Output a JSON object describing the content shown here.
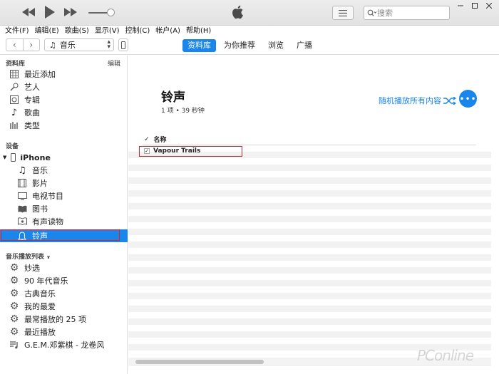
{
  "colors": {
    "accent": "#1a85ea",
    "highlight_border": "#e02020"
  },
  "search": {
    "placeholder": "搜索"
  },
  "menu": [
    "文件(F)",
    "编辑(E)",
    "歌曲(S)",
    "显示(V)",
    "控制(C)",
    "帐户(A)",
    "帮助(H)"
  ],
  "toolbar": {
    "media_type": "音乐"
  },
  "tabs": [
    {
      "label": "资料库",
      "active": true
    },
    {
      "label": "为你推荐",
      "active": false
    },
    {
      "label": "浏览",
      "active": false
    },
    {
      "label": "广播",
      "active": false
    }
  ],
  "sidebar": {
    "library_header": "资料库",
    "edit_label": "编辑",
    "library": [
      {
        "label": "最近添加",
        "icon": "recent-grid-icon"
      },
      {
        "label": "艺人",
        "icon": "microphone-icon"
      },
      {
        "label": "专辑",
        "icon": "album-icon"
      },
      {
        "label": "歌曲",
        "icon": "music-note-icon"
      },
      {
        "label": "类型",
        "icon": "genre-icon"
      }
    ],
    "devices_header": "设备",
    "device_name": "iPhone",
    "device_items": [
      {
        "label": "音乐",
        "icon": "music-note-icon"
      },
      {
        "label": "影片",
        "icon": "film-icon"
      },
      {
        "label": "电视节目",
        "icon": "tv-icon"
      },
      {
        "label": "图书",
        "icon": "book-icon"
      },
      {
        "label": "有声读物",
        "icon": "audiobook-icon"
      },
      {
        "label": "铃声",
        "icon": "bell-icon",
        "selected": true
      }
    ],
    "playlists_header": "音乐播放列表",
    "playlists": [
      {
        "label": "妙选",
        "icon": "smart-playlist-gear-icon"
      },
      {
        "label": "90 年代音乐",
        "icon": "smart-playlist-gear-icon"
      },
      {
        "label": "古典音乐",
        "icon": "smart-playlist-gear-icon"
      },
      {
        "label": "我的最爱",
        "icon": "smart-playlist-gear-icon"
      },
      {
        "label": "最常播放的 25 项",
        "icon": "smart-playlist-gear-icon"
      },
      {
        "label": "最近播放",
        "icon": "smart-playlist-gear-icon"
      },
      {
        "label": "G.E.M.邓紫棋 - 龙卷风",
        "icon": "playlist-icon"
      }
    ]
  },
  "main": {
    "title": "铃声",
    "subtitle": "1 项 • 39 秒钟",
    "shuffle_label": "随机播放所有内容",
    "column_name": "名称",
    "rows": [
      {
        "checked": true,
        "name": "Vapour Trails"
      }
    ]
  },
  "watermark": "PConline"
}
